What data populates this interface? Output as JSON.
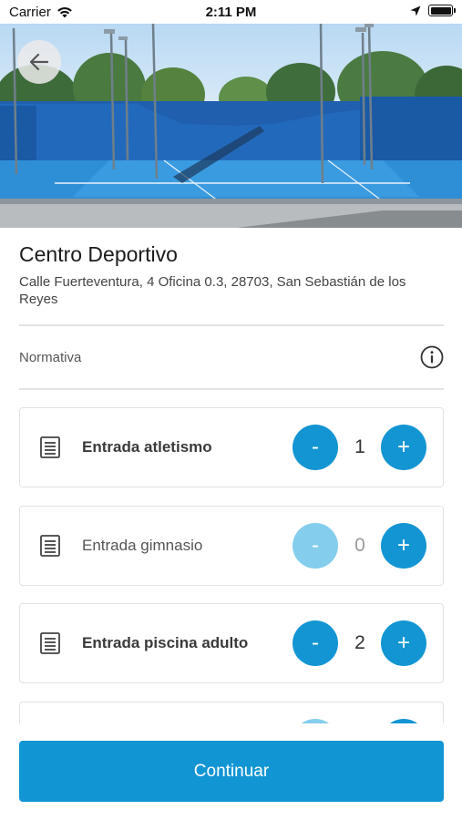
{
  "status_bar": {
    "carrier": "Carrier",
    "time": "2:11 PM"
  },
  "venue": {
    "title": "Centro Deportivo",
    "address": "Calle Fuerteventura, 4 Oficina 0.3, 28703, San Sebastián de los Reyes"
  },
  "rules": {
    "label": "Normativa"
  },
  "tickets": [
    {
      "label": "Entrada atletismo",
      "quantity": "1",
      "minus": "-",
      "plus": "+"
    },
    {
      "label": "Entrada gimnasio",
      "quantity": "0",
      "minus": "-",
      "plus": "+"
    },
    {
      "label": "Entrada piscina adulto",
      "quantity": "2",
      "minus": "-",
      "plus": "+"
    }
  ],
  "continue_label": "Continuar",
  "colors": {
    "accent": "#1295d3",
    "accent_disabled": "#85cdec",
    "court_blue": "#1a6fc0"
  }
}
